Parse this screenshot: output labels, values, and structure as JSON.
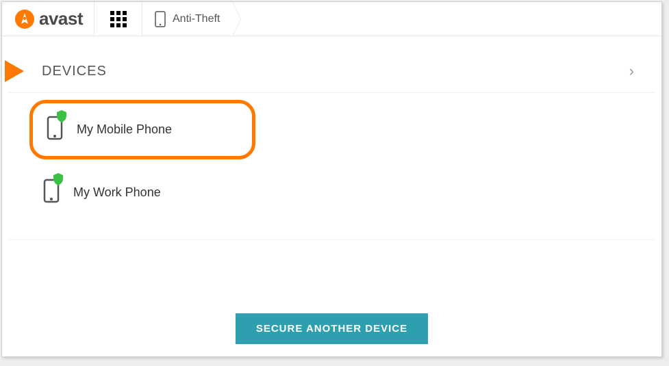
{
  "brand": {
    "name": "avast"
  },
  "breadcrumb": {
    "label": "Anti-Theft"
  },
  "section": {
    "title": "DEVICES"
  },
  "devices": [
    {
      "name": "My Mobile Phone",
      "highlighted": true
    },
    {
      "name": "My Work Phone",
      "highlighted": false
    }
  ],
  "actions": {
    "secure_another": "SECURE ANOTHER DEVICE"
  },
  "colors": {
    "accent": "#ff7800",
    "button": "#2e9faf",
    "shield": "#3ac143"
  }
}
